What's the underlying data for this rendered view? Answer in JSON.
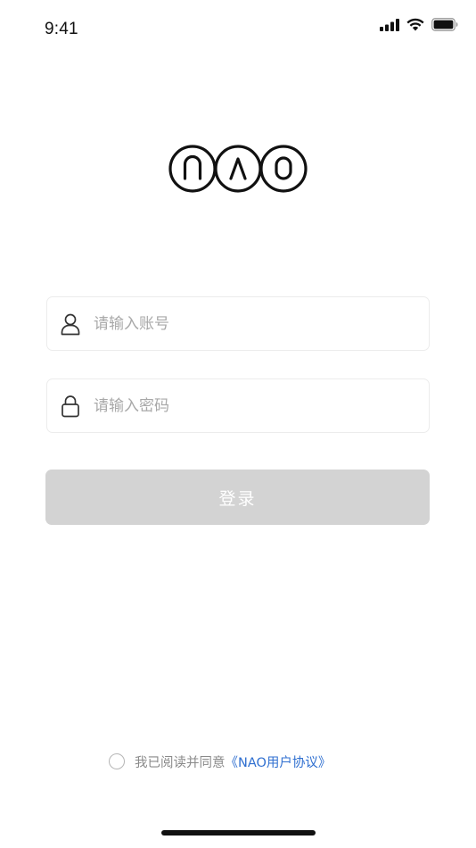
{
  "status_bar": {
    "time": "9:41",
    "icons": [
      "cellular-signal-icon",
      "wifi-icon",
      "battery-icon"
    ]
  },
  "logo": {
    "text": "NAO"
  },
  "form": {
    "account": {
      "placeholder": "请输入账号",
      "value": "",
      "icon": "user-icon"
    },
    "password": {
      "placeholder": "请输入密码",
      "value": "",
      "icon": "lock-icon"
    },
    "login_label": "登录"
  },
  "agreement": {
    "checked": false,
    "text": "我已阅读并同意",
    "link_text": "《NAO用户协议》"
  },
  "colors": {
    "button_disabled": "#d3d3d3",
    "link": "#2f6fd0",
    "placeholder": "#a8a8a8"
  }
}
